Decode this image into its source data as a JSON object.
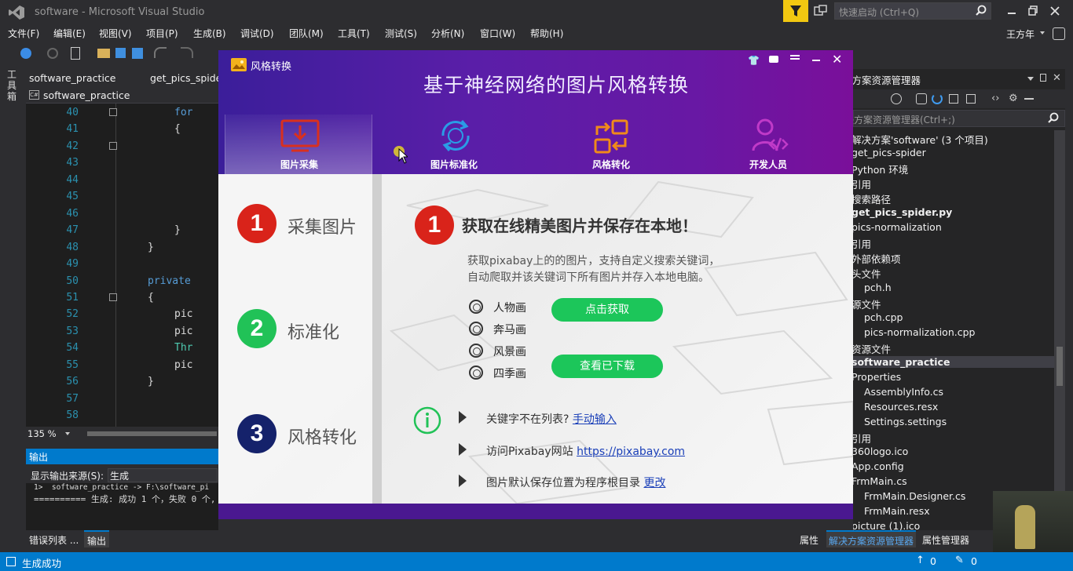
{
  "vs": {
    "title": "software - Microsoft Visual Studio",
    "quick_launch": "快速启动 (Ctrl+Q)",
    "user": "王方年",
    "menus": [
      "文件(F)",
      "编辑(E)",
      "视图(V)",
      "项目(P)",
      "生成(B)",
      "调试(D)",
      "团队(M)",
      "工具(T)",
      "测试(S)",
      "分析(N)",
      "窗口(W)",
      "帮助(H)"
    ],
    "left_strip_label": "工具箱",
    "tabs": [
      "software_practice",
      "get_pics_spider"
    ],
    "file_label": "software_practice",
    "line_numbers": [
      "40",
      "41",
      "42",
      "43",
      "44",
      "45",
      "46",
      "47",
      "48",
      "49",
      "50",
      "51",
      "52",
      "53",
      "54",
      "55",
      "56",
      "57",
      "58"
    ],
    "code_lines": [
      {
        "text": "for",
        "color": "#569cd6"
      },
      {
        "text": "{",
        "color": "#dcdcdc"
      },
      {
        "text": "",
        "color": "#dcdcdc"
      },
      {
        "text": "",
        "color": "#dcdcdc"
      },
      {
        "text": "",
        "color": "#dcdcdc"
      },
      {
        "text": "",
        "color": "#dcdcdc"
      },
      {
        "text": "",
        "color": "#dcdcdc"
      },
      {
        "text": "}",
        "color": "#dcdcdc"
      },
      {
        "text": "}",
        "color": "#dcdcdc"
      },
      {
        "text": "",
        "color": "#dcdcdc"
      },
      {
        "text": "private",
        "color": "#569cd6"
      },
      {
        "text": "{",
        "color": "#dcdcdc"
      },
      {
        "text": "pic",
        "color": "#dcdcdc"
      },
      {
        "text": "pic",
        "color": "#dcdcdc"
      },
      {
        "text": "Thr",
        "color": "#4ec9b0"
      },
      {
        "text": "pic",
        "color": "#dcdcdc"
      },
      {
        "text": "}",
        "color": "#dcdcdc"
      },
      {
        "text": "",
        "color": "#dcdcdc"
      },
      {
        "text": "",
        "color": "#dcdcdc"
      }
    ],
    "zoom": "135 %",
    "output_title": "输出",
    "output_source_label": "显示输出来源(S):",
    "output_source_value": "生成",
    "output_line1": "1>  software_practice -> F:\\software_pi",
    "output_line2": "========== 生成: 成功 1 个，失败 0 个,",
    "bottom_tabs": [
      "错误列表 ...",
      "输出"
    ],
    "right_bottom_tabs": [
      "属性",
      "解决方案资源管理器",
      "属性管理器"
    ],
    "status": "生成成功",
    "status_up": "0",
    "status_edit": "0",
    "solution_title": "决方案资源管理器",
    "solution_search": "决方案资源管理器(Ctrl+;)",
    "solution_items": [
      {
        "text": "解决方案'software' (3 个项目)",
        "indent": 0,
        "bold": false
      },
      {
        "text": "get_pics-spider",
        "indent": 0,
        "bold": false
      },
      {
        "text": "Python 环境",
        "indent": 0,
        "bold": false
      },
      {
        "text": "引用",
        "indent": 0,
        "bold": false
      },
      {
        "text": "搜索路径",
        "indent": 0,
        "bold": false
      },
      {
        "text": "get_pics_spider.py",
        "indent": 0,
        "bold": true
      },
      {
        "text": "pics-normalization",
        "indent": 0,
        "bold": false
      },
      {
        "text": "引用",
        "indent": 0,
        "bold": false
      },
      {
        "text": "外部依赖项",
        "indent": 0,
        "bold": false
      },
      {
        "text": "头文件",
        "indent": 0,
        "bold": false
      },
      {
        "text": "pch.h",
        "indent": 1,
        "bold": false
      },
      {
        "text": "源文件",
        "indent": 0,
        "bold": false
      },
      {
        "text": "pch.cpp",
        "indent": 1,
        "bold": false
      },
      {
        "text": "pics-normalization.cpp",
        "indent": 1,
        "bold": false
      },
      {
        "text": "资源文件",
        "indent": 0,
        "bold": false
      },
      {
        "text": "software_practice",
        "indent": 0,
        "bold": true
      },
      {
        "text": "Properties",
        "indent": 0,
        "bold": false
      },
      {
        "text": "AssemblyInfo.cs",
        "indent": 1,
        "bold": false
      },
      {
        "text": "Resources.resx",
        "indent": 1,
        "bold": false
      },
      {
        "text": "Settings.settings",
        "indent": 1,
        "bold": false
      },
      {
        "text": "引用",
        "indent": 0,
        "bold": false
      },
      {
        "text": "360logo.ico",
        "indent": 0,
        "bold": false
      },
      {
        "text": "App.config",
        "indent": 0,
        "bold": false
      },
      {
        "text": "FrmMain.cs",
        "indent": 0,
        "bold": false
      },
      {
        "text": "FrmMain.Designer.cs",
        "indent": 1,
        "bold": false
      },
      {
        "text": "FrmMain.resx",
        "indent": 1,
        "bold": false
      },
      {
        "text": "picture (1).ico",
        "indent": 0,
        "bold": false
      }
    ]
  },
  "app": {
    "window_title": "风格转换",
    "heading": "基于神经网络的图片风格转换",
    "nav_tabs": [
      {
        "label": "图片采集",
        "icon": "download-monitor-icon",
        "color": "#d9301e"
      },
      {
        "label": "图片标准化",
        "icon": "refresh-cycle-icon",
        "color": "#2a9ce6"
      },
      {
        "label": "风格转化",
        "icon": "swap-arrows-icon",
        "color": "#f08a1a"
      },
      {
        "label": "开发人员",
        "icon": "developer-user-icon",
        "color": "#c03ac8"
      }
    ],
    "steps": [
      {
        "num": "1",
        "label": "采集图片",
        "color": "#d9231a"
      },
      {
        "num": "2",
        "label": "标准化",
        "color": "#21c257"
      },
      {
        "num": "3",
        "label": "风格转化",
        "color": "#15226b"
      }
    ],
    "main_num": "1",
    "main_title": "获取在线精美图片并保存在本地！",
    "desc_line1": "获取pixabay上的的图片，支持自定义搜索关键词，",
    "desc_line2": "自动爬取并该关键词下所有图片并存入本地电脑。",
    "options": [
      "人物画",
      "奔马画",
      "风景画",
      "四季画"
    ],
    "btn_fetch": "点击获取",
    "btn_view": "查看已下载",
    "info_items": [
      {
        "text": "关键字不在列表?",
        "link": "手动输入"
      },
      {
        "text": "访问Pixabay网站",
        "link": "https://pixabay.com"
      },
      {
        "text": "图片默认保存位置为程序根目录",
        "link": "更改"
      }
    ]
  }
}
